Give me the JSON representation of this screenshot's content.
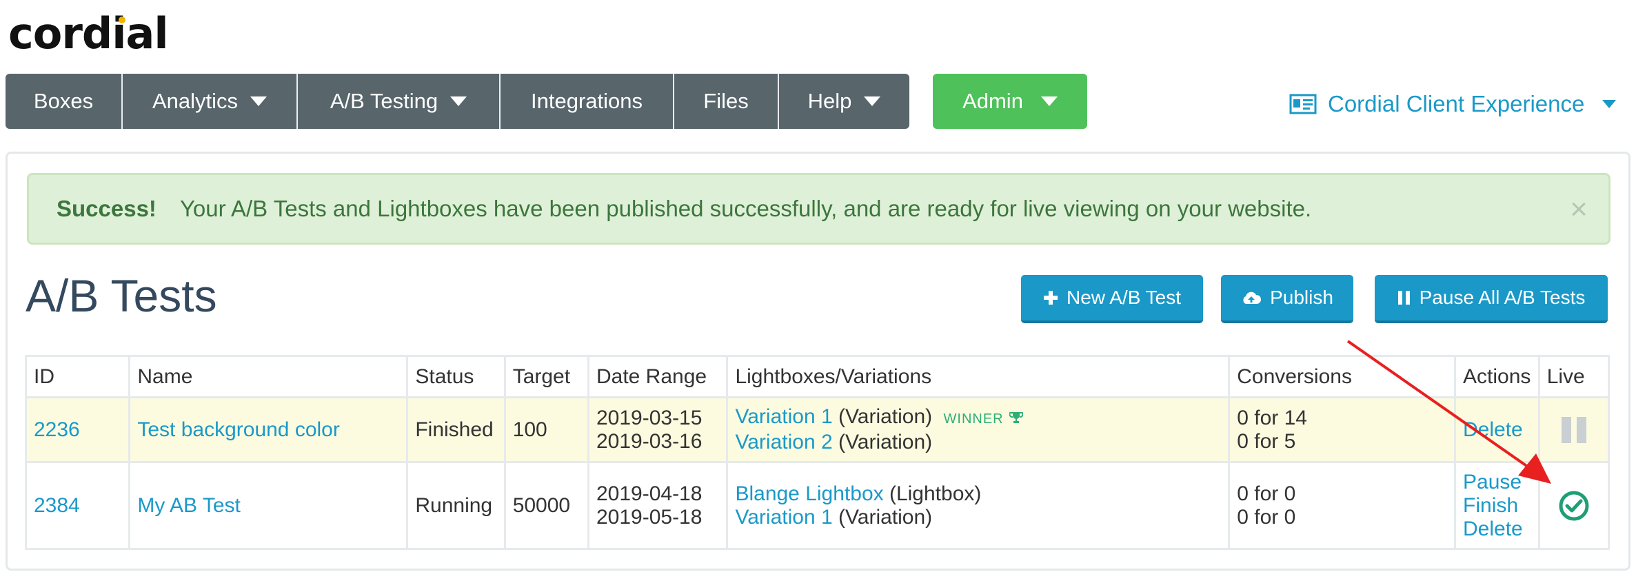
{
  "app": {
    "logo_text": "cordial"
  },
  "nav": {
    "items": [
      {
        "label": "Boxes",
        "has_caret": false
      },
      {
        "label": "Analytics",
        "has_caret": true
      },
      {
        "label": "A/B Testing",
        "has_caret": true
      },
      {
        "label": "Integrations",
        "has_caret": false
      },
      {
        "label": "Files",
        "has_caret": false
      },
      {
        "label": "Help",
        "has_caret": true
      }
    ],
    "admin_label": "Admin",
    "client_label": "Cordial Client Experience"
  },
  "alert": {
    "title": "Success!",
    "message": "Your A/B Tests and Lightboxes have been published successfully, and are ready for live viewing on your website.",
    "close": "×"
  },
  "page": {
    "title": "A/B Tests",
    "buttons": {
      "new_test": "New A/B Test",
      "publish": "Publish",
      "pause_all": "Pause All A/B Tests"
    }
  },
  "table": {
    "headers": [
      "ID",
      "Name",
      "Status",
      "Target",
      "Date Range",
      "Lightboxes/Variations",
      "Conversions",
      "Actions",
      "Live"
    ],
    "rows": [
      {
        "id": "2236",
        "name": "Test background color",
        "status": "Finished",
        "target": "100",
        "date_start": "2019-03-15",
        "date_end": "2019-03-16",
        "variations": [
          {
            "link": "Variation 1",
            "type": "(Variation)",
            "badge": "WINNER"
          },
          {
            "link": "Variation 2",
            "type": "(Variation)",
            "badge": ""
          }
        ],
        "conversions": [
          "0 for 14",
          "0 for 5"
        ],
        "actions": [
          "Delete"
        ],
        "live": "paused"
      },
      {
        "id": "2384",
        "name": "My AB Test",
        "status": "Running",
        "target": "50000",
        "date_start": "2019-04-18",
        "date_end": "2019-05-18",
        "variations": [
          {
            "link": "Blange Lightbox",
            "type": "(Lightbox)",
            "badge": ""
          },
          {
            "link": "Variation 1",
            "type": "(Variation)",
            "badge": ""
          }
        ],
        "conversions": [
          "0 for 0",
          "0 for 0"
        ],
        "actions": [
          "Pause",
          "Finish",
          "Delete"
        ],
        "live": "live"
      }
    ]
  },
  "colors": {
    "nav_bg": "#58656b",
    "admin_green": "#4fc15a",
    "link_blue": "#1a99c9",
    "success_bg": "#dff0d8",
    "winner_green": "#2dae77",
    "arrow_red": "#e8201f"
  }
}
